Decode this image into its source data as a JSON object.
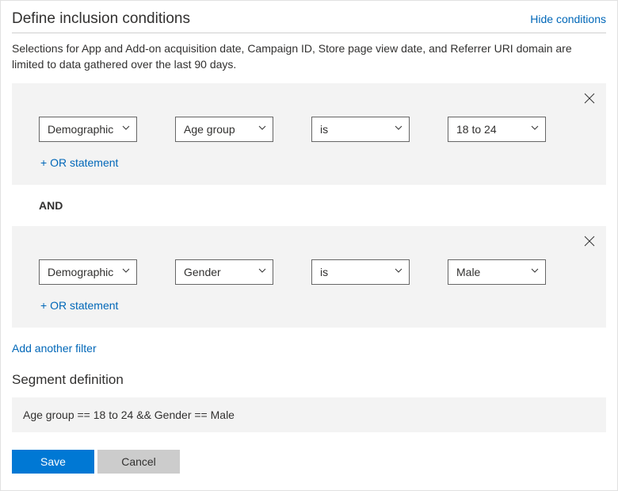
{
  "header": {
    "title": "Define inclusion conditions",
    "hide_link": "Hide conditions"
  },
  "description": "Selections for App and Add-on acquisition date, Campaign ID, Store page view date, and Referrer URI domain are limited to data gathered over the last 90 days.",
  "filters": [
    {
      "category": "Demographic",
      "attribute": "Age group",
      "operator": "is",
      "value": "18 to 24",
      "or_label": "+ OR statement"
    },
    {
      "category": "Demographic",
      "attribute": "Gender",
      "operator": "is",
      "value": "Male",
      "or_label": "+ OR statement"
    }
  ],
  "and_label": "AND",
  "add_filter_label": "Add another filter",
  "segment": {
    "title": "Segment definition",
    "expression": "Age group == 18 to 24 && Gender == Male"
  },
  "buttons": {
    "save": "Save",
    "cancel": "Cancel"
  }
}
